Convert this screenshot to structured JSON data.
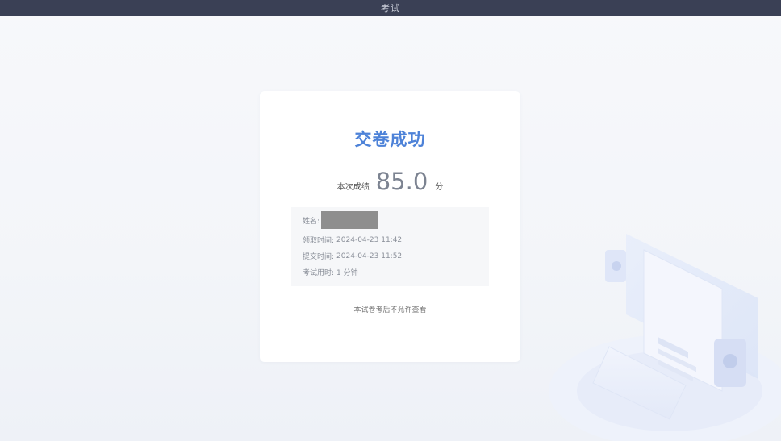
{
  "header": {
    "title": "考试"
  },
  "result": {
    "title": "交卷成功",
    "score_label": "本次成绩",
    "score_value": "85.0",
    "score_unit": "分"
  },
  "info": {
    "name_label": "姓名:",
    "receive_label": "领取时间:",
    "receive_time": "2024-04-23 11:42",
    "submit_label": "提交时间:",
    "submit_time": "2024-04-23 11:52",
    "duration_label": "考试用时:",
    "duration_value": "1 分钟"
  },
  "note": "本试卷考后不允许查看",
  "illustration": {
    "icon": "receipt-document-illustration"
  }
}
